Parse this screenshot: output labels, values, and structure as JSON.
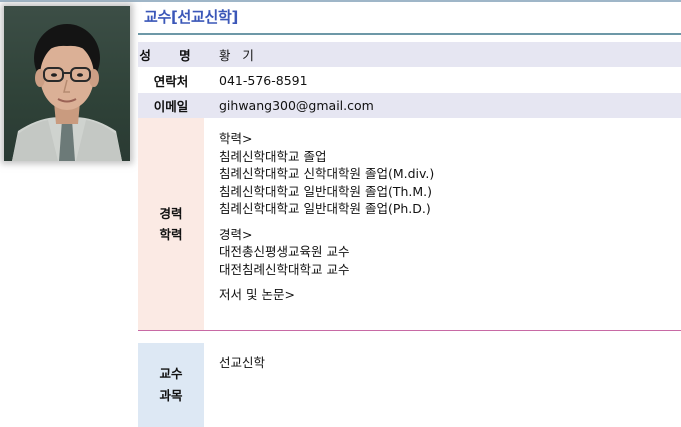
{
  "profile": {
    "title": "교수[선교신학]",
    "name_label": "성 명",
    "name": "황   기",
    "phone_label": "연락처",
    "phone": "041-576-8591",
    "email_label": "이메일",
    "email": "gihwang300@gmail.com",
    "career_label_1": "경력",
    "career_label_2": "학력",
    "education_heading": "학력>",
    "education": [
      "침례신학대학교 졸업",
      "침례신학대학교 신학대학원 졸업(M.div.)",
      "침례신학대학교 일반대학원 졸업(Th.M.)",
      "침례신학대학교 일반대학원 졸업(Ph.D.)"
    ],
    "career_heading": "경력>",
    "career": [
      "대전총신평생교육원 교수",
      "대전침례신학대학교 교수"
    ],
    "publications_heading": "저서 및 논문>",
    "course_label_1": "교수",
    "course_label_2": "과목",
    "course": "선교신학"
  },
  "colors": {
    "title": "#3b57b8",
    "row_shade": "#e6e6f2",
    "career_label_bg": "#fbeae4",
    "course_label_bg": "#dde8f4",
    "career_rule": "#c86aa5"
  },
  "icons": {
    "photo": "portrait-photo"
  }
}
